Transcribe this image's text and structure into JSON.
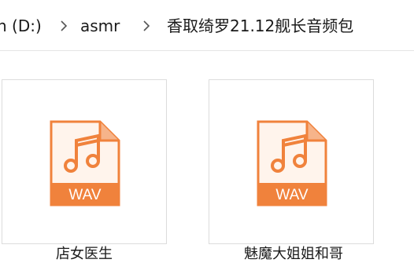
{
  "breadcrumb": {
    "items": [
      {
        "label": "n (D:)"
      },
      {
        "label": "asmr"
      },
      {
        "label": "香取绮罗21.12舰长音频包"
      }
    ]
  },
  "files": [
    {
      "icon": "wav-file-icon",
      "type_label": "WAV",
      "name": "店女医生"
    },
    {
      "icon": "wav-file-icon",
      "type_label": "WAV",
      "name": "魅魔大姐姐和哥"
    }
  ],
  "colors": {
    "wav_orange": "#f0823c",
    "wav_fold": "#f6b48a"
  }
}
